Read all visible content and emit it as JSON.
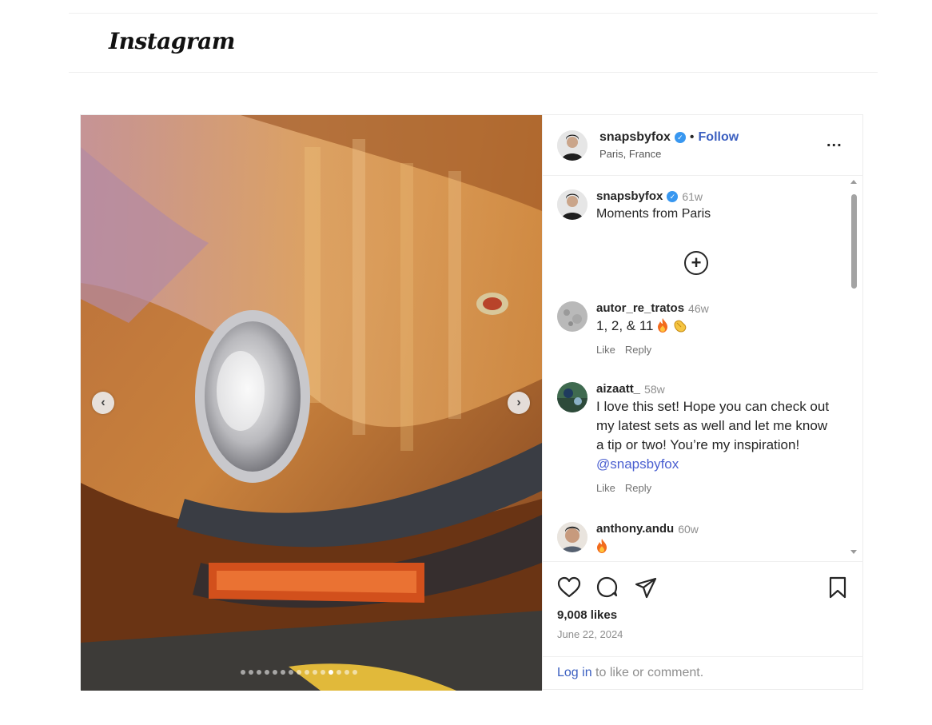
{
  "header": {
    "logo_text": "Instagram"
  },
  "post": {
    "author": {
      "username": "snapsbyfox",
      "separator": "•",
      "follow_label": "Follow",
      "location": "Paris, France"
    },
    "more_label": "...",
    "caption": {
      "username": "snapsbyfox",
      "time": "61w",
      "text": "Moments from Paris"
    },
    "load_more_label": "+",
    "comments": [
      {
        "username": "autor_re_tratos",
        "time": "46w",
        "text": "1, 2, & 11",
        "emojis": [
          "fire-emoji",
          "clapping-hands-emoji"
        ],
        "like_label": "Like",
        "reply_label": "Reply"
      },
      {
        "username": "aizaatt_",
        "time": "58w",
        "text": "I love this set! Hope you can check out my latest sets as well and let me know a tip or two! You’re my inspiration!",
        "mention": "@snapsbyfox",
        "like_label": "Like",
        "reply_label": "Reply"
      },
      {
        "username": "anthony.andu",
        "time": "60w",
        "emojis": [
          "fire-emoji"
        ]
      }
    ],
    "likes": "9,008 likes",
    "date": "June 22, 2024",
    "login_prompt": {
      "link": "Log in",
      "rest": " to like or comment."
    },
    "carousel": {
      "prev_icon": "chevron-left-icon",
      "next_icon": "chevron-right-icon",
      "total_slides": 15,
      "active_slide": 12
    }
  },
  "colors": {
    "link": "#3b5fc0",
    "verified": "#3897f0",
    "muted": "#8e8e8e",
    "border": "#efefef"
  }
}
